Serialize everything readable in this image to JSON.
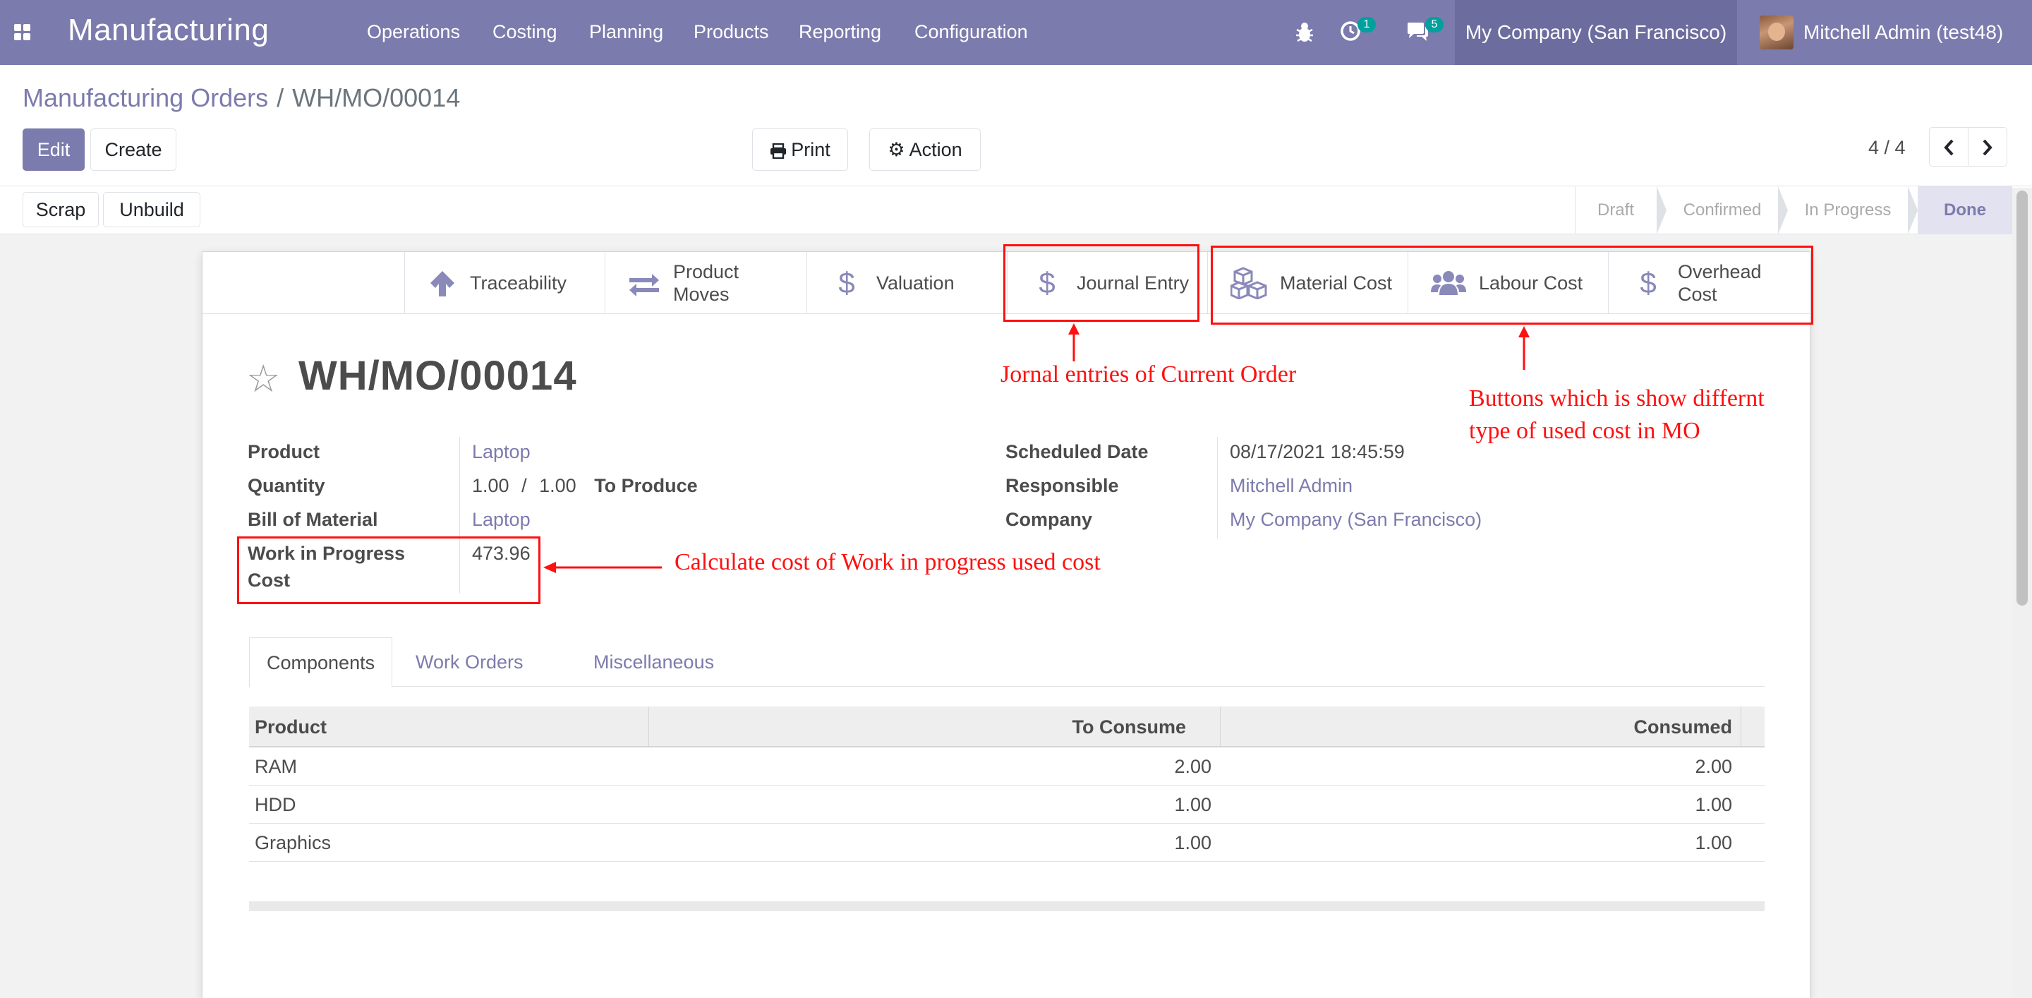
{
  "navbar": {
    "app_title": "Manufacturing",
    "menu": [
      "Operations",
      "Costing",
      "Planning",
      "Products",
      "Reporting",
      "Configuration"
    ],
    "activity_count": "1",
    "message_count": "5",
    "company": "My Company (San Francisco)",
    "user": "Mitchell Admin (test48)"
  },
  "breadcrumb": {
    "parent": "Manufacturing Orders",
    "separator": "/",
    "current": "WH/MO/00014"
  },
  "buttons": {
    "edit": "Edit",
    "create": "Create",
    "print": "Print",
    "action": "Action",
    "scrap": "Scrap",
    "unbuild": "Unbuild"
  },
  "pager": {
    "value": "4 / 4"
  },
  "status_steps": [
    "Draft",
    "Confirmed",
    "In Progress",
    "Done"
  ],
  "status_current": "Done",
  "smart_buttons": {
    "traceability": "Traceability",
    "product_moves": "Product Moves",
    "valuation": "Valuation",
    "journal_entry": "Journal Entry",
    "material_cost": "Material Cost",
    "labour_cost": "Labour Cost",
    "overhead_cost": "Overhead Cost"
  },
  "record": {
    "name": "WH/MO/00014",
    "product_label": "Product",
    "product": "Laptop",
    "quantity_label": "Quantity",
    "quantity_done": "1.00",
    "quantity_sep": "/",
    "quantity_total": "1.00",
    "quantity_suffix": "To Produce",
    "bom_label": "Bill of Material",
    "bom": "Laptop",
    "wip_label": "Work in Progress Cost",
    "wip_value": "473.96",
    "scheduled_label": "Scheduled Date",
    "scheduled": "08/17/2021 18:45:59",
    "responsible_label": "Responsible",
    "responsible": "Mitchell Admin",
    "company_label": "Company",
    "company": "My Company (San Francisco)"
  },
  "tabs": [
    "Components",
    "Work Orders",
    "Miscellaneous"
  ],
  "components": {
    "headers": [
      "Product",
      "To Consume",
      "Consumed"
    ],
    "rows": [
      [
        "RAM",
        "2.00",
        "2.00"
      ],
      [
        "HDD",
        "1.00",
        "1.00"
      ],
      [
        "Graphics",
        "1.00",
        "1.00"
      ]
    ]
  },
  "annotations": {
    "journal": "Jornal entries of Current Order",
    "cost_buttons_line1": "Buttons which is show differnt",
    "cost_buttons_line2": "type of used cost in MO",
    "wip": "Calculate cost of Work in progress used cost"
  },
  "colors": {
    "brand": "#7c7bad",
    "annotation": "#ff1010"
  }
}
